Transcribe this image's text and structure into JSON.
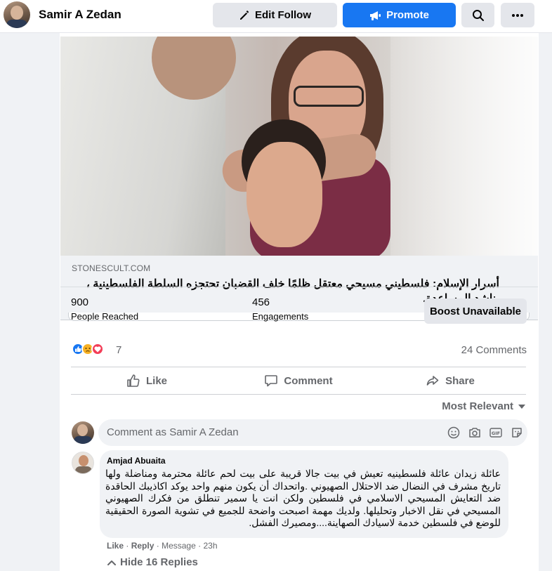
{
  "header": {
    "page_name": "Samir A Zedan",
    "edit_follow_label": "Edit Follow",
    "promote_label": "Promote"
  },
  "link_preview": {
    "domain": "STONESCULT.COM",
    "title": "أسرار الإسلام: فلسطيني مسيحي معتقل ظلمًا خلف القضبان تحتجزه السلطة الفلسطينية ، يناشد المساعدة."
  },
  "insights": {
    "people_reached_value": "900",
    "people_reached_label": "People Reached",
    "engagements_value": "456",
    "engagements_label": "Engagements",
    "boost_label": "Boost Unavailable"
  },
  "reactions": {
    "icons": [
      "like-icon",
      "sad-icon",
      "love-icon"
    ],
    "count": "7",
    "comments_count": "24 Comments"
  },
  "actions": {
    "like": "Like",
    "comment": "Comment",
    "share": "Share"
  },
  "comments_section": {
    "sort_label": "Most Relevant",
    "composer_placeholder": "Comment as Samir A Zedan"
  },
  "comment": {
    "author": "Amjad Abuaita",
    "text": "عائلة زيدان عائلة فلسطينيه تعيش في بيت جالا قريبة على بيت لحم عائلة محترمة ومناضلة ولها تاريخ مشرف في النضال ضد الاحتلال الصهيوني .واتحداك أن يكون منهم واحد يوكد اكاذيبك الحاقدة ضد التعايش المسيحي الاسلامي في فلسطين ولكن انت يا سمير تنطلق من فكرك الصهيوني المسيحي في نقل الاخبار وتحليلها. ولديك مهمة اصبحت واضحة للجميع في تشوية الصورة الحقيقية للوضع في فلسطين خدمة لاسيادك الصهاينة....ومصيرك الفشل.",
    "like_label": "Like",
    "reply_label": "Reply",
    "message_label": "Message",
    "time": "23h",
    "hide_replies_label": "Hide 16 Replies"
  },
  "colors": {
    "accent": "#1877f2",
    "background": "#f0f2f5",
    "secondary_text": "#65676b"
  }
}
